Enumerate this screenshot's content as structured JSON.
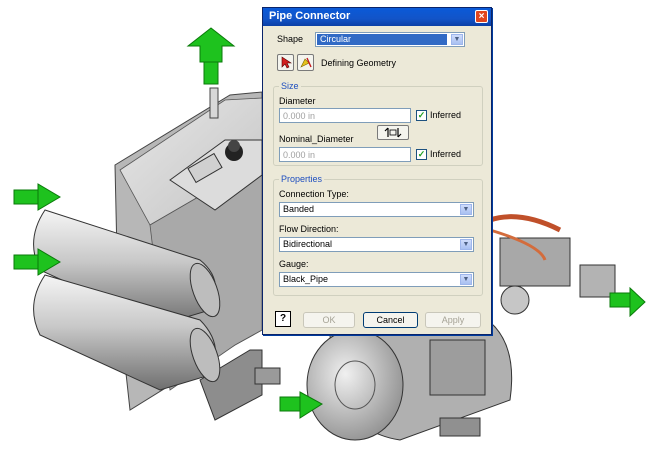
{
  "dialog": {
    "title": "Pipe Connector",
    "close_glyph": "×",
    "shape": {
      "label": "Shape",
      "value": "Circular"
    },
    "defining_geometry_label": "Defining Geometry",
    "size": {
      "header": "Size",
      "diameter_label": "Diameter",
      "diameter_value": "0.000 in",
      "diameter_inferred_label": "Inferred",
      "nominal_label": "Nominal_Diameter",
      "nominal_value": "0.000 in",
      "nominal_inferred_label": "Inferred"
    },
    "properties": {
      "header": "Properties",
      "connection_type_label": "Connection Type:",
      "connection_type_value": "Banded",
      "flow_direction_label": "Flow Direction:",
      "flow_direction_value": "Bidirectional",
      "gauge_label": "Gauge:",
      "gauge_value": "Black_Pipe"
    },
    "buttons": {
      "help": "?",
      "ok": "OK",
      "cancel": "Cancel",
      "apply": "Apply"
    }
  },
  "icons": {
    "select": "select-cursor-icon",
    "geometry": "geometry-pick-icon",
    "swap": "swap-icon",
    "arrows": "connector-arrow-icon"
  },
  "colors": {
    "title_bar": "#1254c8",
    "arrow_green": "#1ec21e",
    "dialog_bg": "#ece9d8",
    "group_header": "#1f4fbf"
  }
}
